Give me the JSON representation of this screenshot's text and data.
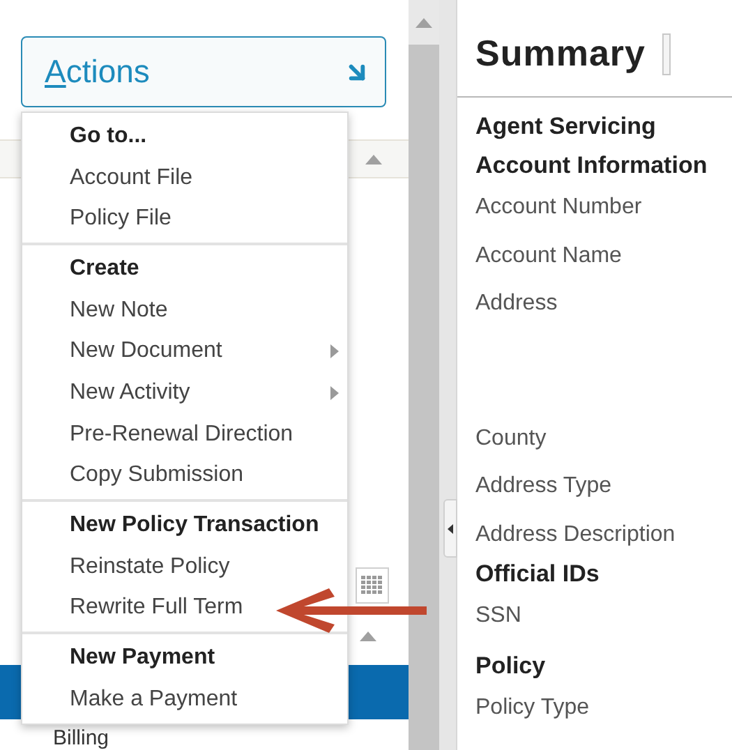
{
  "actions_button": {
    "label": "Actions"
  },
  "menu": {
    "sections": [
      {
        "heading": "Go to...",
        "items": [
          {
            "label": "Account File",
            "has_submenu": false
          },
          {
            "label": "Policy File",
            "has_submenu": false
          }
        ]
      },
      {
        "heading": "Create",
        "items": [
          {
            "label": "New Note",
            "has_submenu": false
          },
          {
            "label": "New Document",
            "has_submenu": true
          },
          {
            "label": "New Activity",
            "has_submenu": true
          },
          {
            "label": "Pre-Renewal Direction",
            "has_submenu": false
          },
          {
            "label": "Copy Submission",
            "has_submenu": false
          }
        ]
      },
      {
        "heading": "New Policy Transaction",
        "items": [
          {
            "label": "Reinstate Policy",
            "has_submenu": false
          },
          {
            "label": "Rewrite Full Term",
            "has_submenu": false
          }
        ]
      },
      {
        "heading": "New Payment",
        "items": [
          {
            "label": "Make a Payment",
            "has_submenu": false
          }
        ]
      }
    ]
  },
  "background_list": {
    "item": "Billing"
  },
  "summary": {
    "title": "Summary",
    "rows": [
      {
        "kind": "heading",
        "label": "Agent Servicing"
      },
      {
        "kind": "heading",
        "label": "Account Information"
      },
      {
        "kind": "field",
        "label": "Account Number"
      },
      {
        "kind": "field",
        "label": "Account Name"
      },
      {
        "kind": "field",
        "label": "Address"
      },
      {
        "kind": "field",
        "label": "County"
      },
      {
        "kind": "field",
        "label": "Address Type"
      },
      {
        "kind": "field",
        "label": "Address Description"
      },
      {
        "kind": "heading",
        "label": "Official IDs"
      },
      {
        "kind": "field",
        "label": "SSN"
      },
      {
        "kind": "heading",
        "label": "Policy"
      },
      {
        "kind": "field",
        "label": "Policy Type"
      }
    ]
  }
}
